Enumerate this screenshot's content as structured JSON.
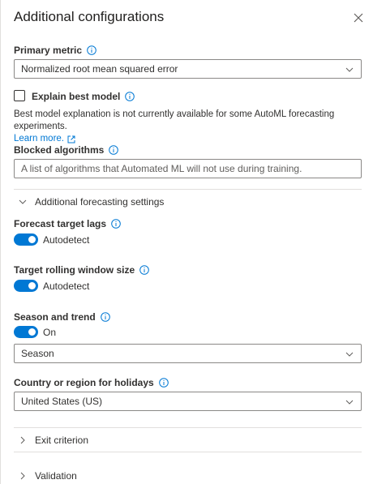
{
  "panel": {
    "title": "Additional configurations",
    "close_icon": "close-icon"
  },
  "primary_metric": {
    "label": "Primary metric",
    "value": "Normalized root mean squared error"
  },
  "explain_model": {
    "label": "Explain best model",
    "checked": false,
    "note": "Best model explanation is not currently available for some AutoML forecasting experiments.",
    "learn_more": "Learn more."
  },
  "blocked_algorithms": {
    "label": "Blocked algorithms",
    "placeholder": "A list of algorithms that Automated ML will not use during training."
  },
  "forecasting_section": {
    "label": "Additional forecasting settings",
    "expanded": true
  },
  "forecast_target_lags": {
    "label": "Forecast target lags",
    "toggle_label": "Autodetect",
    "on": true
  },
  "target_rolling_window": {
    "label": "Target rolling window size",
    "toggle_label": "Autodetect",
    "on": true
  },
  "season_trend": {
    "label": "Season and trend",
    "toggle_label": "On",
    "on": true,
    "value": "Season"
  },
  "holidays": {
    "label": "Country or region for holidays",
    "value": "United States (US)"
  },
  "exit_criterion": {
    "label": "Exit criterion"
  },
  "validation": {
    "label": "Validation"
  },
  "colors": {
    "accent": "#0078d4",
    "border": "#8a8886",
    "text": "#323130"
  }
}
